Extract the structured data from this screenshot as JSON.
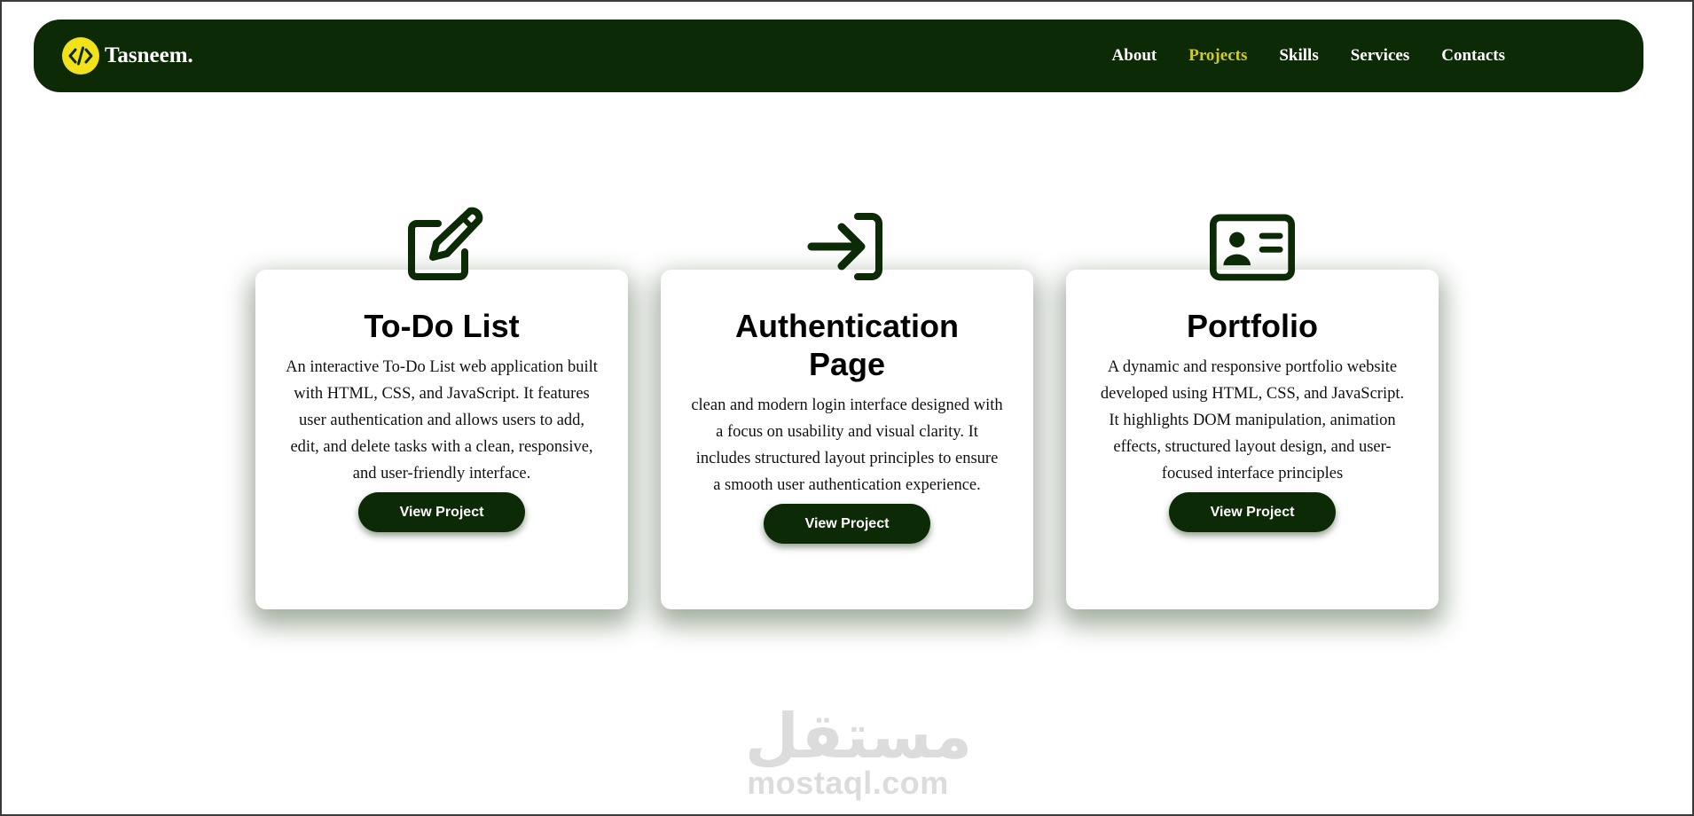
{
  "brand": {
    "name": "Tasneem.",
    "logo_icon": "code-icon",
    "logo_color": "#f2e21c"
  },
  "nav": {
    "items": [
      {
        "label": "About",
        "active": false
      },
      {
        "label": "Projects",
        "active": true
      },
      {
        "label": "Skills",
        "active": false
      },
      {
        "label": "Services",
        "active": false
      },
      {
        "label": "Contacts",
        "active": false
      }
    ]
  },
  "colors": {
    "primary": "#0d2a06",
    "accent": "#d4cb21"
  },
  "projects": [
    {
      "icon": "edit-icon",
      "title": "To-Do List",
      "description": "An interactive To-Do List web application built with HTML, CSS, and JavaScript. It features user authentication and allows users to add, edit, and delete tasks with a clean, responsive, and user-friendly interface.",
      "button": "View Project"
    },
    {
      "icon": "login-icon",
      "title": "Authentication Page",
      "description": "clean and modern login interface designed with a focus on usability and visual clarity. It includes structured layout principles to ensure a smooth user authentication experience.",
      "button": "View Project"
    },
    {
      "icon": "id-card-icon",
      "title": "Portfolio",
      "description": "A dynamic and responsive portfolio website developed using HTML, CSS, and JavaScript. It highlights DOM manipulation, animation effects, structured layout design, and user-focused interface principles",
      "button": "View Project"
    }
  ],
  "watermark": {
    "arabic": "مستقل",
    "latin": "mostaql.com"
  }
}
